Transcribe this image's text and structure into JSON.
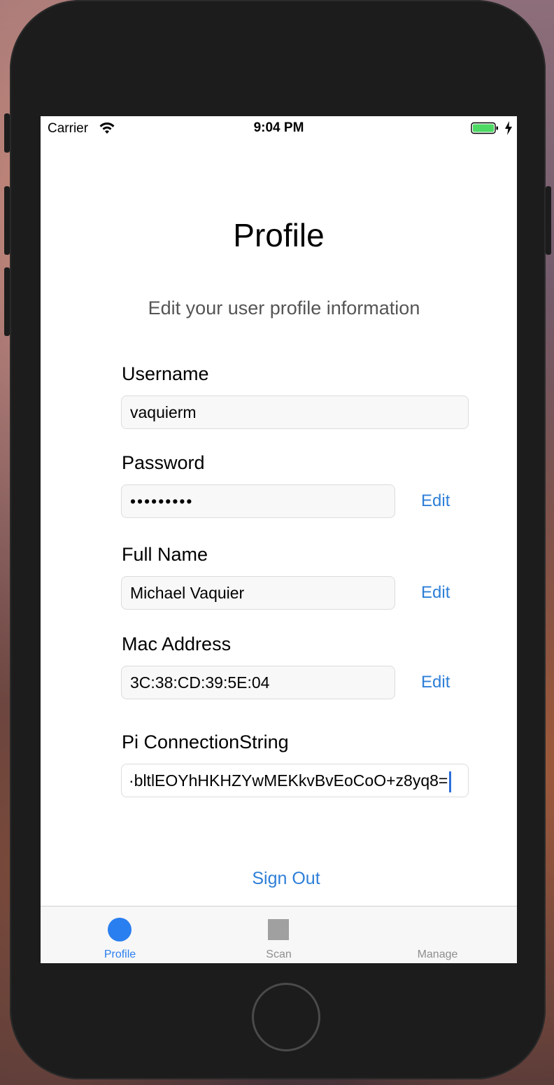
{
  "status_bar": {
    "carrier": "Carrier",
    "time": "9:04 PM"
  },
  "header": {
    "title": "Profile",
    "subtitle": "Edit your user profile information"
  },
  "form": {
    "username": {
      "label": "Username",
      "value": "vaquierm"
    },
    "password": {
      "label": "Password",
      "value": "•••••••••",
      "edit_label": "Edit"
    },
    "full_name": {
      "label": "Full Name",
      "value": "Michael Vaquier",
      "edit_label": "Edit"
    },
    "mac_address": {
      "label": "Mac Address",
      "value": "3C:38:CD:39:5E:04",
      "edit_label": "Edit"
    },
    "pi_connection_string": {
      "label": "Pi ConnectionString",
      "value": "·bltlEOYhHKHZYwMEKkvBvEoCoO+z8yq8="
    }
  },
  "sign_out_label": "Sign Out",
  "tab_bar": {
    "tabs": [
      {
        "label": "Profile",
        "icon": "circle-icon",
        "active": true
      },
      {
        "label": "Scan",
        "icon": "square-icon",
        "active": false
      },
      {
        "label": "Manage",
        "icon": "none",
        "active": false
      }
    ]
  },
  "colors": {
    "accent": "#2a7ff0",
    "link": "#2e7fd8",
    "battery": "#4cd964",
    "inactive_tab": "#8e8e8e"
  }
}
